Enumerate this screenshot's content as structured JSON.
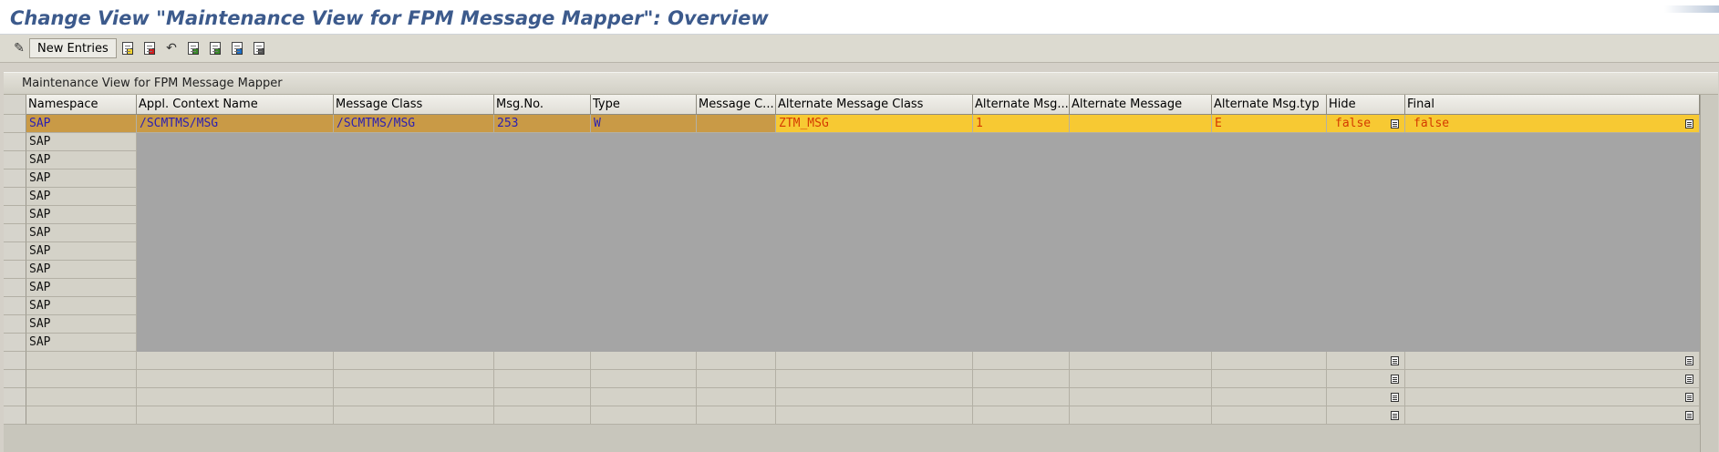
{
  "window": {
    "title": "Change View \"Maintenance View for FPM Message Mapper\": Overview"
  },
  "toolbar": {
    "new_entries_label": "New Entries",
    "icons": [
      "display-change-icon",
      "copy-icon",
      "delete-icon",
      "undo-icon",
      "select-all-icon",
      "select-block-icon",
      "deselect-all-icon",
      "print-icon"
    ]
  },
  "panel": {
    "title": "Maintenance View for FPM Message Mapper"
  },
  "table": {
    "columns": [
      "Namespace",
      "Appl. Context Name",
      "Message Class",
      "Msg.No.",
      "Type",
      "Message C...",
      "Alternate Message Class",
      "Alternate Msg...",
      "Alternate Message",
      "Alternate Msg.typ",
      "Hide",
      "Final"
    ],
    "first_row": {
      "namespace": "SAP",
      "appl_context_name": "/SCMTMS/MSG",
      "message_class": "/SCMTMS/MSG",
      "msg_no": "253",
      "type": "W",
      "message_c": "",
      "alternate_message_class": "ZTM_MSG",
      "alternate_msg_no": "1",
      "alternate_message": "",
      "alternate_msg_type": "E",
      "hide": "false",
      "final": "false"
    },
    "namespace_rows": [
      "SAP",
      "SAP",
      "SAP",
      "SAP",
      "SAP",
      "SAP",
      "SAP",
      "SAP",
      "SAP",
      "SAP",
      "SAP",
      "SAP"
    ]
  },
  "colors": {
    "title": "#3c5a8c",
    "row_context": "#c99a46",
    "row_alternate": "#f7c933",
    "text_blue": "#2a1fb3",
    "text_orange": "#d43a00"
  }
}
